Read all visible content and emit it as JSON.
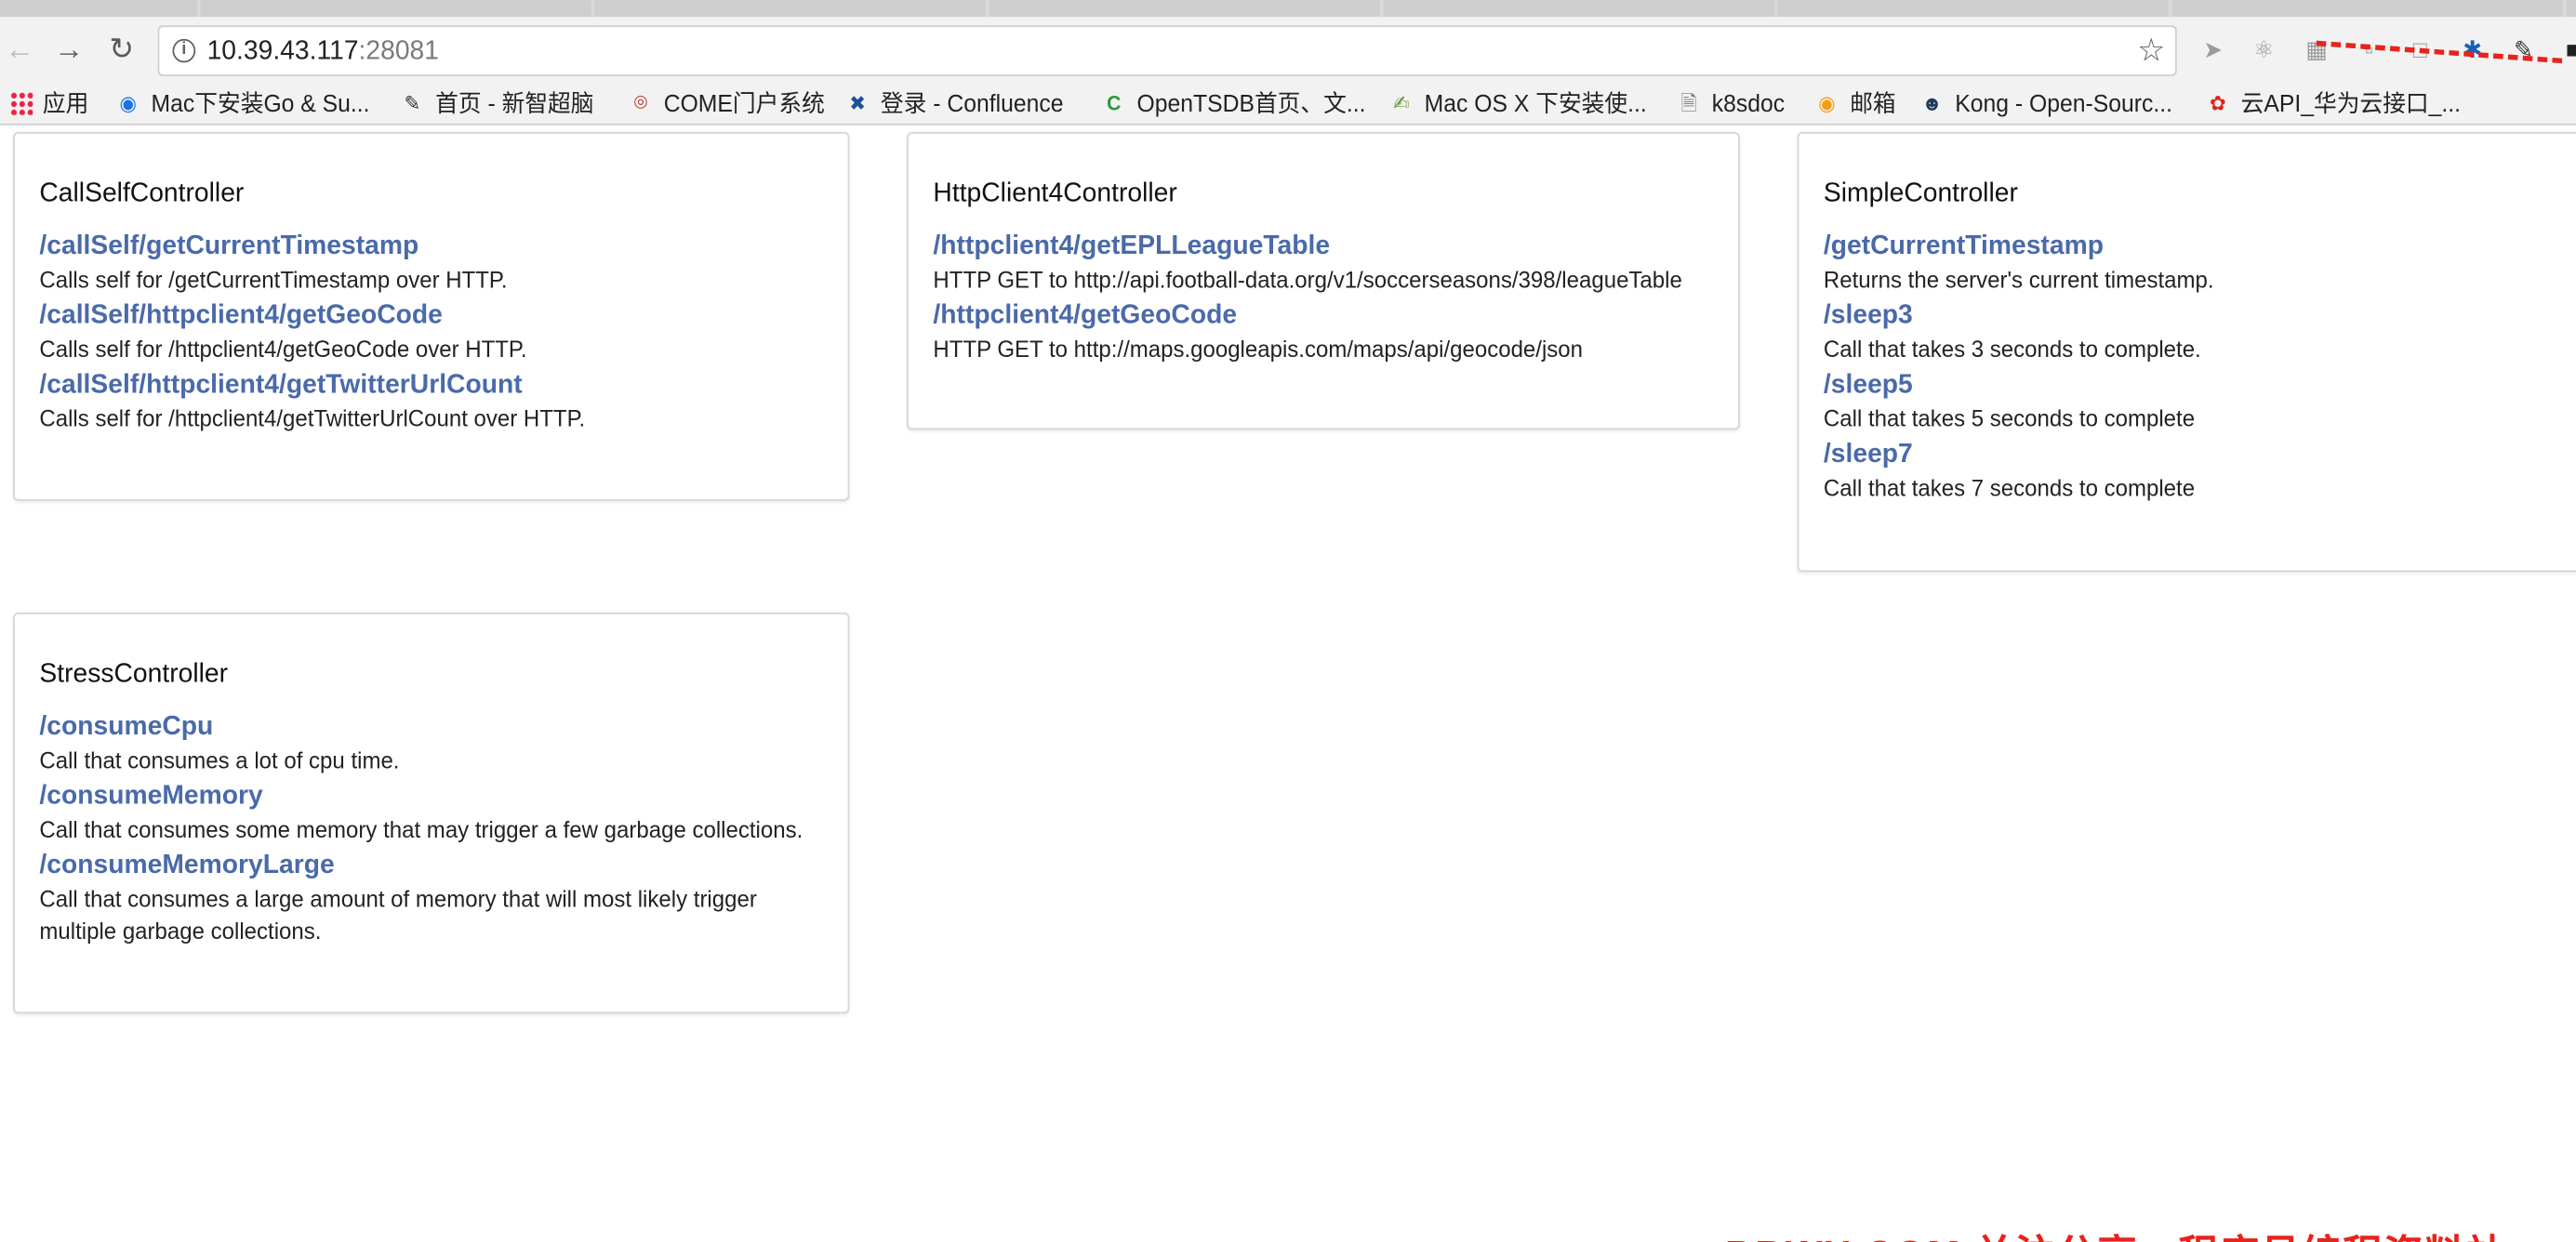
{
  "browser": {
    "url_host": "10.39.43.117",
    "url_port": ":28081",
    "bookmarks": [
      {
        "label": "应用",
        "icon": "apps-grid-icon"
      },
      {
        "label": "Mac下安装Go & Su...",
        "icon": "c-logo-icon"
      },
      {
        "label": "首页 - 新智超脑",
        "icon": "edit-icon"
      },
      {
        "label": "COME门户系统",
        "icon": "globe-icon"
      },
      {
        "label": "登录 - Confluence",
        "icon": "confluence-icon"
      },
      {
        "label": "OpenTSDB首页、文...",
        "icon": "c-green-icon"
      },
      {
        "label": "Mac OS X 下安装使...",
        "icon": "notepad-icon"
      },
      {
        "label": "k8sdoc",
        "icon": "file-icon"
      },
      {
        "label": "邮箱",
        "icon": "mail-icon"
      },
      {
        "label": "Kong - Open-Sourc...",
        "icon": "kong-icon"
      },
      {
        "label": "云API_华为云接口_...",
        "icon": "huawei-icon"
      }
    ]
  },
  "controllers": {
    "callself": {
      "title": "CallSelfController",
      "endpoints": [
        {
          "path": "/callSelf/getCurrentTimestamp",
          "desc": "Calls self for /getCurrentTimestamp over HTTP."
        },
        {
          "path": "/callSelf/httpclient4/getGeoCode",
          "desc": "Calls self for /httpclient4/getGeoCode over HTTP."
        },
        {
          "path": "/callSelf/httpclient4/getTwitterUrlCount",
          "desc": "Calls self for /httpclient4/getTwitterUrlCount over HTTP."
        }
      ]
    },
    "httpclient": {
      "title": "HttpClient4Controller",
      "endpoints": [
        {
          "path": "/httpclient4/getEPLLeagueTable",
          "desc": "HTTP GET to http://api.football-data.org/v1/soccerseasons/398/leagueTable"
        },
        {
          "path": "/httpclient4/getGeoCode",
          "desc": "HTTP GET to http://maps.googleapis.com/maps/api/geocode/json"
        }
      ]
    },
    "simple": {
      "title": "SimpleController",
      "endpoints": [
        {
          "path": "/getCurrentTimestamp",
          "desc": "Returns the server's current timestamp."
        },
        {
          "path": "/sleep3",
          "desc": "Call that takes 3 seconds to complete."
        },
        {
          "path": "/sleep5",
          "desc": "Call that takes 5 seconds to complete"
        },
        {
          "path": "/sleep7",
          "desc": "Call that takes 7 seconds to complete"
        }
      ]
    },
    "stress": {
      "title": "StressController",
      "endpoints": [
        {
          "path": "/consumeCpu",
          "desc": "Call that consumes a lot of cpu time."
        },
        {
          "path": "/consumeMemory",
          "desc": "Call that consumes some memory that may trigger a few garbage collections."
        },
        {
          "path": "/consumeMemoryLarge",
          "desc": "Call that consumes a large amount of memory that will most likely trigger multiple garbage collections."
        }
      ]
    }
  },
  "colors": {
    "link": "#4a6aa9",
    "watermark": "#e8231b"
  },
  "watermark_text": "BBWX.COM 关注分享 · 程序员编程资料站"
}
